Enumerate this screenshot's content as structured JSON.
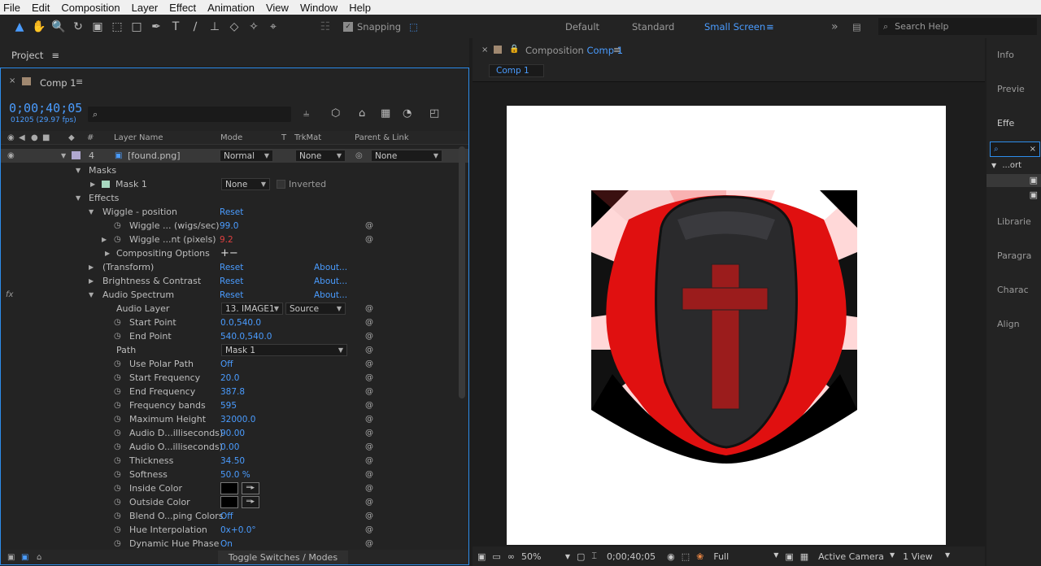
{
  "menu": [
    "File",
    "Edit",
    "Composition",
    "Layer",
    "Effect",
    "Animation",
    "View",
    "Window",
    "Help"
  ],
  "toolbar": {
    "snapping": "Snapping",
    "workspaces": [
      "Default",
      "Standard",
      "Small Screen"
    ],
    "active_workspace": "Small Screen",
    "search_placeholder": "Search Help"
  },
  "project": {
    "tab": "Project"
  },
  "timeline": {
    "tab": "Comp 1",
    "timecode": "0;00;40;05",
    "frames": "01205 (29.97 fps)",
    "columns": {
      "num": "#",
      "layer_name": "Layer Name",
      "mode": "Mode",
      "t": "T",
      "trkmat": "TrkMat",
      "parent": "Parent & Link"
    },
    "layer": {
      "num": "4",
      "name": "[found.png]",
      "mode": "Normal",
      "trkmat": "None",
      "parent": "None"
    },
    "masks_label": "Masks",
    "mask1": {
      "name": "Mask 1",
      "mode": "None",
      "inverted": "Inverted"
    },
    "effects_label": "Effects",
    "wiggle": {
      "name": "Wiggle - position",
      "reset": "Reset",
      "rate_label": "Wiggle ... (wigs/sec)",
      "rate": "99.0",
      "amount_label": "Wiggle ...nt (pixels)",
      "amount": "9.2",
      "compositing": "Compositing Options"
    },
    "transform": {
      "name": "(Transform)",
      "reset": "Reset",
      "about": "About..."
    },
    "brightness": {
      "name": "Brightness & Contrast",
      "reset": "Reset",
      "about": "About..."
    },
    "audio": {
      "name": "Audio Spectrum",
      "reset": "Reset",
      "about": "About..."
    },
    "props": [
      {
        "label": "Audio Layer",
        "value": "",
        "dd1": "13. IMAGE1",
        "dd2": "Source"
      },
      {
        "label": "Start Point",
        "value": "0.0,540.0"
      },
      {
        "label": "End Point",
        "value": "540.0,540.0"
      },
      {
        "label": "Path",
        "value": "",
        "dd1": "Mask 1"
      },
      {
        "label": "Use Polar Path",
        "value": "Off"
      },
      {
        "label": "Start Frequency",
        "value": "20.0"
      },
      {
        "label": "End Frequency",
        "value": "387.8"
      },
      {
        "label": "Frequency bands",
        "value": "595"
      },
      {
        "label": "Maximum Height",
        "value": "32000.0"
      },
      {
        "label": "Audio D...illiseconds)",
        "value": "90.00"
      },
      {
        "label": "Audio O...illiseconds)",
        "value": "0.00"
      },
      {
        "label": "Thickness",
        "value": "34.50"
      },
      {
        "label": "Softness",
        "value": "50.0 %"
      },
      {
        "label": "Inside Color",
        "value": ""
      },
      {
        "label": "Outside Color",
        "value": ""
      },
      {
        "label": "Blend O...ping Colors",
        "value": "Off"
      },
      {
        "label": "Hue Interpolation",
        "value": "0x+0.0°"
      },
      {
        "label": "Dynamic Hue Phase",
        "value": "On"
      }
    ],
    "toggle": "Toggle Switches / Modes"
  },
  "composition": {
    "tab_prefix": "Composition",
    "tab_name": "Comp 1",
    "sub_tab": "Comp 1",
    "zoom": "50%",
    "time": "0;00;40;05",
    "resolution": "Full",
    "camera": "Active Camera",
    "views": "1 View"
  },
  "right_panels": [
    "Info",
    "Previe",
    "Effe",
    "Librarie",
    "Paragra",
    "Charac",
    "Align"
  ],
  "effects_search": "...ort"
}
